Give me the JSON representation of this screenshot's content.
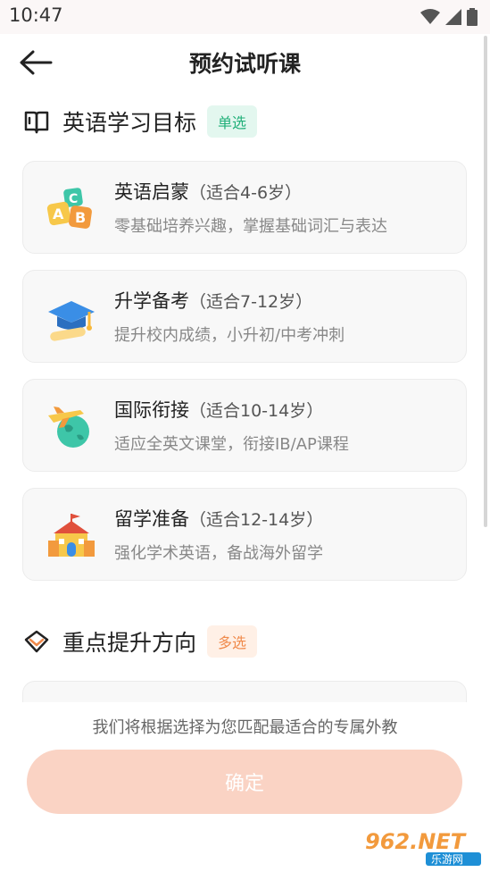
{
  "status": {
    "time": "10:47"
  },
  "header": {
    "title": "预约试听课"
  },
  "section_goal": {
    "title": "英语学习目标",
    "tag": "单选"
  },
  "cards": [
    {
      "title": "英语启蒙",
      "age": "（适合4-6岁）",
      "desc": "零基础培养兴趣，掌握基础词汇与表达",
      "icon": "abc-blocks-icon"
    },
    {
      "title": "升学备考",
      "age": "（适合7-12岁）",
      "desc": "提升校内成绩，小升初/中考冲刺",
      "icon": "graduation-cap-icon"
    },
    {
      "title": "国际衔接",
      "age": "（适合10-14岁）",
      "desc": "适应全英文课堂，衔接IB/AP课程",
      "icon": "globe-plane-icon"
    },
    {
      "title": "留学准备",
      "age": "（适合12-14岁）",
      "desc": "强化学术英语，备战海外留学",
      "icon": "school-building-icon"
    }
  ],
  "section_focus": {
    "title": "重点提升方向",
    "tag": "多选"
  },
  "footer": {
    "hint": "我们将根据选择为您匹配最适合的专属外教",
    "confirm": "确定"
  },
  "watermark": {
    "text": "962.NET",
    "sub": "乐游网"
  },
  "colors": {
    "accent_green": "#22b07a",
    "accent_orange": "#f08a4b",
    "confirm_bg": "#fad3c4"
  }
}
